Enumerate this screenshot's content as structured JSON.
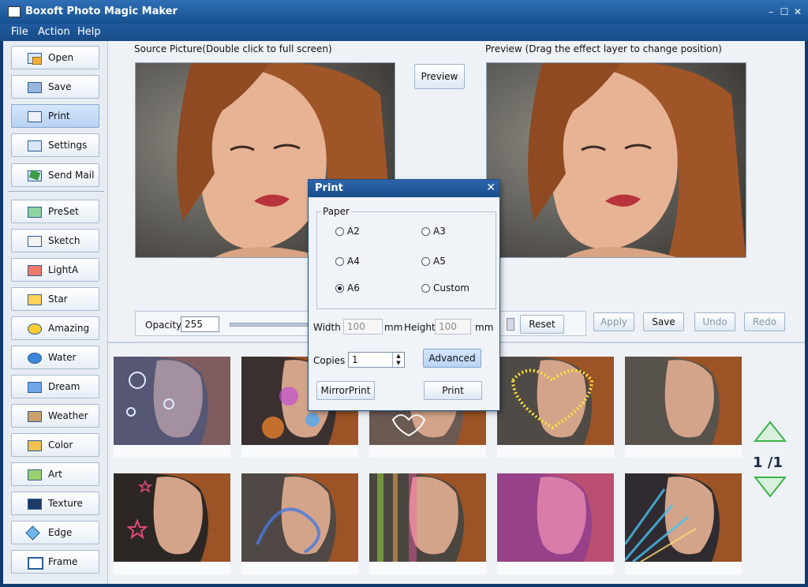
{
  "window": {
    "title": "Boxoft Photo Magic Maker"
  },
  "menu": [
    "File",
    "Action",
    "Help"
  ],
  "sidebar": {
    "file_buttons": [
      {
        "label": "Open",
        "icon": "open-folder-icon"
      },
      {
        "label": "Save",
        "icon": "save-disk-icon"
      },
      {
        "label": "Print",
        "icon": "printer-icon"
      },
      {
        "label": "Settings",
        "icon": "settings-gear-icon"
      },
      {
        "label": "Send Mail",
        "icon": "send-mail-icon"
      }
    ],
    "effect_buttons": [
      {
        "label": "PreSet",
        "icon": "preset-icon"
      },
      {
        "label": "Sketch",
        "icon": "sketch-icon"
      },
      {
        "label": "LightA",
        "icon": "light-icon"
      },
      {
        "label": "Star",
        "icon": "star-icon"
      },
      {
        "label": "Amazing",
        "icon": "amazing-icon"
      },
      {
        "label": "Water",
        "icon": "water-drop-icon"
      },
      {
        "label": "Dream",
        "icon": "dream-icon"
      },
      {
        "label": "Weather",
        "icon": "weather-icon"
      },
      {
        "label": "Color",
        "icon": "color-icon"
      },
      {
        "label": "Art",
        "icon": "art-icon"
      },
      {
        "label": "Texture",
        "icon": "texture-icon"
      },
      {
        "label": "Edge",
        "icon": "edge-icon"
      },
      {
        "label": "Frame",
        "icon": "frame-icon"
      }
    ],
    "active": "Print"
  },
  "main": {
    "source_caption": "Source Picture(Double click to full screen)",
    "preview_caption": "Preview (Drag the effect layer to change position)",
    "preview_button": "Preview",
    "opacity_label": "Opacity",
    "opacity_value": "255",
    "reset_button": "Reset",
    "apply_button": "Apply",
    "save_button": "Save",
    "undo_button": "Undo",
    "redo_button": "Redo",
    "pager": "1 /1"
  },
  "dialog": {
    "title": "Print",
    "paper_label": "Paper",
    "papers": [
      "A2",
      "A3",
      "A4",
      "A5",
      "A6",
      "Custom"
    ],
    "selected_paper": "A6",
    "width_label": "Width :",
    "width_value": "100",
    "height_label": "Height :",
    "height_value": "100",
    "unit": "mm",
    "copies_label": "Copies :",
    "copies_value": "1",
    "advanced_button": "Advanced",
    "mirror_button": "MirrorPrint",
    "print_button": "Print"
  },
  "thumbnails": [
    {
      "effect": "water bubbles",
      "tint": "#4a6fc9"
    },
    {
      "effect": "colorful bokeh",
      "tint": "#c04fd0"
    },
    {
      "effect": "hearts",
      "tint": "#e9e9ff"
    },
    {
      "effect": "gold heart sparkle",
      "tint": "#ffe23b"
    },
    {
      "effect": "plain",
      "tint": "#c98a5c"
    },
    {
      "effect": "pink stars",
      "tint": "#e0497a"
    },
    {
      "effect": "blue swirl",
      "tint": "#4a78e0"
    },
    {
      "effect": "light streaks",
      "tint": "#9cdf3f"
    },
    {
      "effect": "magenta tint",
      "tint": "#e04bd1"
    },
    {
      "effect": "light burst",
      "tint": "#46c2f2"
    }
  ],
  "colors": {
    "accent": "#1a4c8b",
    "panel": "#e7ecf3",
    "arrow": "#3bb44a"
  }
}
